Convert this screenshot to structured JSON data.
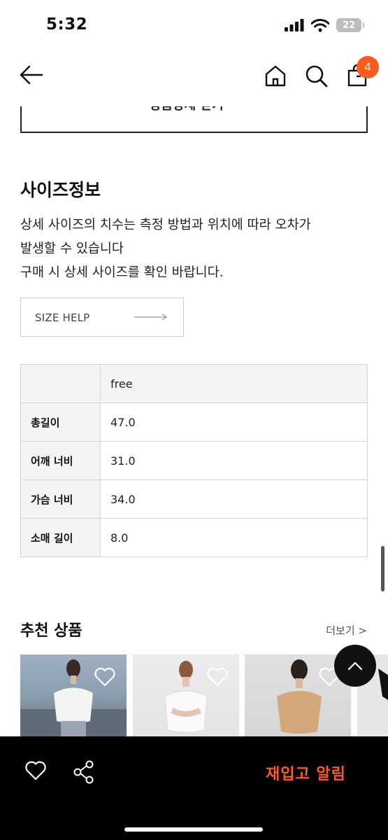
{
  "status_bar": {
    "time": "5:32",
    "battery": "22"
  },
  "header": {
    "cart_count": "4"
  },
  "detail_toggle": {
    "label": "상품상세 닫기 ^"
  },
  "size_info": {
    "title": "사이즈정보",
    "desc_lines": [
      "상세 사이즈의 치수는 측정 방법과 위치에 따라 오차가",
      "발생할 수 있습니다",
      "구매 시 상세 사이즈를 확인 바랍니다."
    ],
    "size_help_label": "SIZE HELP",
    "table": {
      "header": "free",
      "rows": [
        {
          "label": "총길이",
          "value": "47.0"
        },
        {
          "label": "어깨 너비",
          "value": "31.0"
        },
        {
          "label": "가슴 너비",
          "value": "34.0"
        },
        {
          "label": "소매 길이",
          "value": "8.0"
        }
      ]
    }
  },
  "recommended": {
    "title": "추천 상품",
    "more_label": "더보기 >"
  },
  "bottom_bar": {
    "restock_label": "재입고 알림"
  },
  "colors": {
    "accent": "#ff5a1f",
    "bar": "#000000"
  }
}
